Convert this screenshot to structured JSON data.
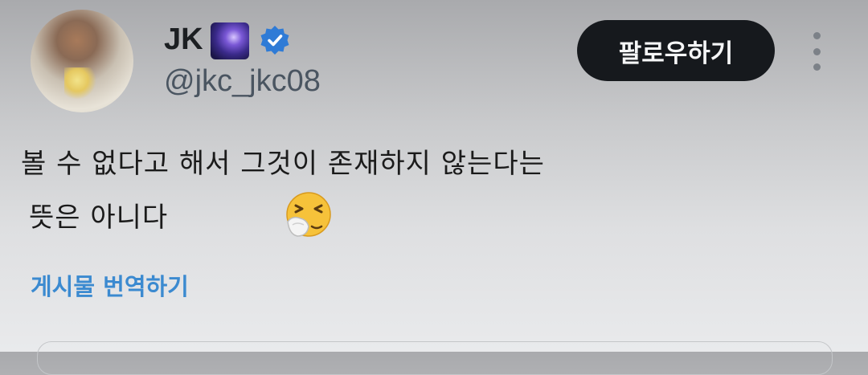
{
  "user": {
    "name": "JK",
    "handle": "@jkc_jkc08"
  },
  "actions": {
    "follow_label": "팔로우하기",
    "more_icon": "more-vertical-icon"
  },
  "post": {
    "line1": "볼 수 없다고 해서 그것이 존재하지 않는다는",
    "line2": "뜻은 아니다",
    "emoji": "sneezing-face-emoji",
    "translate_label": "게시물 번역하기"
  },
  "colors": {
    "follow_bg": "#16191d",
    "translate_link": "#3b8ad0",
    "verified_badge": "#2f7bd6"
  }
}
